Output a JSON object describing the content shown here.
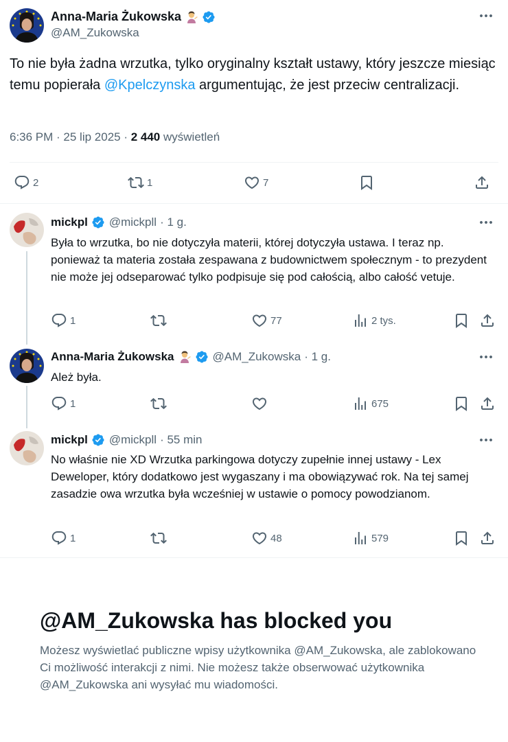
{
  "main_tweet": {
    "name": "Anna-Maria Żukowska",
    "emoji": "💁🏻‍♀️",
    "handle": "@AM_Zukowska",
    "text_before": "To nie była żadna wrzutka, tylko oryginalny kształt ustawy, który jeszcze miesiąc temu popierała ",
    "mention": "@Kpelczynska",
    "text_after": " argumentując, że jest przeciw centralizacji.",
    "time": "6:36 PM · 25 lip 2025 · ",
    "views_count": "2 440",
    "views_label": " wyświetleń",
    "replies": "2",
    "retweets": "1",
    "likes": "7"
  },
  "replies": [
    {
      "name": "mickpl",
      "handle": "@mickpll",
      "time": "· 1 g.",
      "text": "Była to wrzutka, bo nie dotyczyła materii, której dotyczyła ustawa. I teraz np. ponieważ ta materia została zespawana z budownictwem społecznym - to prezydent nie może jej odseparować tylko podpisuje się pod całością, albo całość vetuje.",
      "replies": "1",
      "retweets": "",
      "likes": "77",
      "views": "2 tys."
    },
    {
      "name": "Anna-Maria Żukowska",
      "emoji": "💁🏻‍♀️",
      "handle": "@AM_Zukowska",
      "time": "· 1 g.",
      "text": "Ależ była.",
      "replies": "1",
      "retweets": "",
      "likes": "",
      "views": "675"
    },
    {
      "name": "mickpl",
      "handle": "@mickpll",
      "time": "· 55 min",
      "text": "No właśnie nie XD Wrzutka parkingowa dotyczy zupełnie innej ustawy - Lex Deweloper, który dodatkowo jest wygaszany i ma obowiązywać rok. Na tej samej zasadzie owa wrzutka była wcześniej w ustawie o pomocy powodzianom.",
      "replies": "1",
      "retweets": "",
      "likes": "48",
      "views": "579"
    }
  ],
  "blocked": {
    "title": "@AM_Zukowska has blocked you",
    "text": "Możesz wyświetlać publiczne wpisy użytkownika @AM_Zukowska, ale zablokowano Ci możliwość interakcji z nimi. Nie możesz także obserwować użytkownika @AM_Zukowska ani wysyłać mu wiadomości."
  },
  "colors": {
    "accent": "#1d9bf0",
    "muted": "#536471",
    "text": "#0f1419",
    "border": "#eff3f4"
  },
  "icons": [
    "reply-icon",
    "retweet-icon",
    "like-icon",
    "bookmark-icon",
    "share-icon",
    "views-icon",
    "verified-icon",
    "more-icon"
  ]
}
